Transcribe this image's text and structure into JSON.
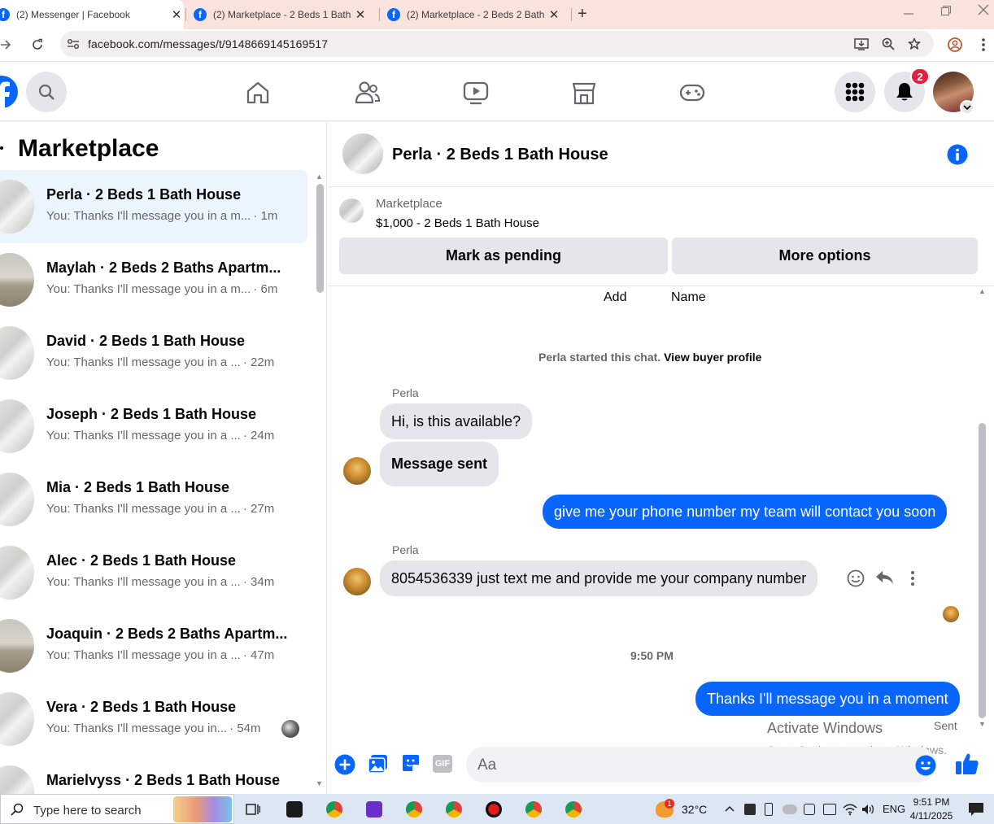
{
  "browser": {
    "tabs": [
      {
        "title": "(2) Messenger | Facebook",
        "active": true
      },
      {
        "title": "(2) Marketplace - 2 Beds 1 Bath",
        "active": false
      },
      {
        "title": "(2) Marketplace - 2 Beds 2 Bath",
        "active": false
      }
    ],
    "new_tab": "+",
    "close": "✕",
    "url": "facebook.com/messages/t/9148669145169517"
  },
  "fbnav": {
    "notification_count": "2"
  },
  "sidebar": {
    "heading": "Marketplace",
    "conversations": [
      {
        "name": "Perla · 2 Beds 1 Bath House",
        "preview": "You: Thanks I'll message you in a m...",
        "time": "· 1m"
      },
      {
        "name": "Maylah · 2 Beds 2 Baths Apartm...",
        "preview": "You: Thanks I'll message you in a m...",
        "time": "· 6m"
      },
      {
        "name": "David · 2 Beds 1 Bath House",
        "preview": "You: Thanks I'll message you in a ...",
        "time": "· 22m"
      },
      {
        "name": "Joseph · 2 Beds 1 Bath House",
        "preview": "You: Thanks I'll message you in a ...",
        "time": "· 24m"
      },
      {
        "name": "Mia · 2 Beds 1 Bath House",
        "preview": "You: Thanks I'll message you in a ...",
        "time": "· 27m"
      },
      {
        "name": "Alec · 2 Beds 1 Bath House",
        "preview": "You: Thanks I'll message you in a ...",
        "time": "· 34m"
      },
      {
        "name": "Joaquin · 2 Beds 2 Baths Apartm...",
        "preview": "You: Thanks I'll message you in a ...",
        "time": "· 47m"
      },
      {
        "name": "Vera · 2 Beds 1 Bath House",
        "preview": "You: Thanks I'll message you in...",
        "time": "· 54m"
      },
      {
        "name": "Marielvyss · 2 Beds 1 Bath House",
        "preview": "",
        "time": ""
      }
    ]
  },
  "chat": {
    "title": "Perla · 2 Beds 1 Bath House",
    "listing_source": "Marketplace",
    "listing_title": "$1,000 - 2 Beds 1 Bath House",
    "mark_pending": "Mark as pending",
    "more_options": "More options",
    "add_label": "Add",
    "name_label": "Name",
    "started_text": "Perla started this chat.",
    "view_profile": "View buyer profile",
    "sender_1": "Perla",
    "msg_1": "Hi, is this available?",
    "msg_2": "Message sent",
    "msg_3": "give me your phone number my team will contact you soon",
    "sender_2": "Perla",
    "msg_4": "8054536339 just text me and provide me your company number",
    "timestamp": "9:50 PM",
    "msg_5": "Thanks I'll message you in a moment",
    "status": "Sent",
    "composer_placeholder": "Aa",
    "gif_label": "GIF"
  },
  "watermark": {
    "line1": "Activate Windows",
    "line2": "Go to Settings to activate Windows."
  },
  "taskbar": {
    "search_placeholder": "Type here to search",
    "weather": "32°C",
    "weather_badge": "1",
    "language": "ENG",
    "time": "9:51 PM",
    "date": "4/11/2025"
  }
}
